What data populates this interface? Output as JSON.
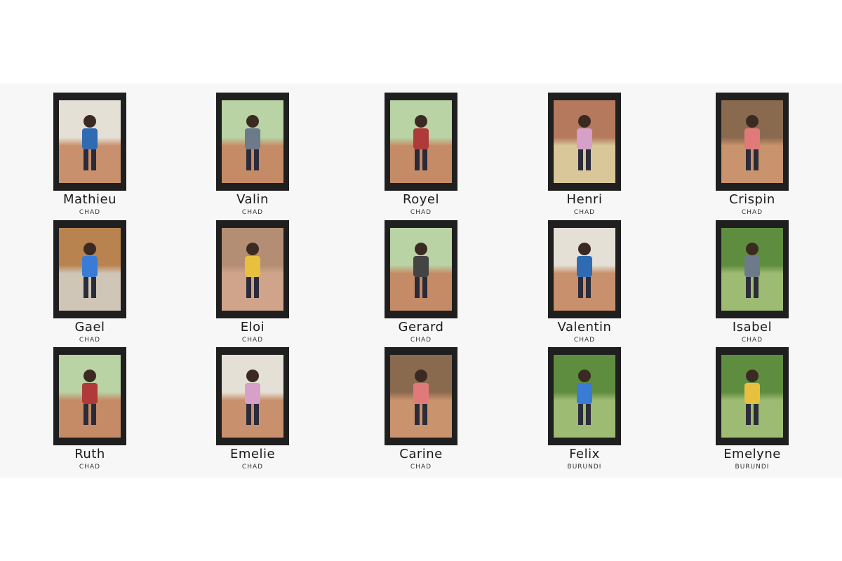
{
  "children": [
    {
      "name": "Mathieu",
      "country": "CHAD",
      "scene": "sand"
    },
    {
      "name": "Valin",
      "country": "CHAD",
      "scene": "field"
    },
    {
      "name": "Royel",
      "country": "CHAD",
      "scene": "field"
    },
    {
      "name": "Henri",
      "country": "CHAD",
      "scene": "mat"
    },
    {
      "name": "Crispin",
      "country": "CHAD",
      "scene": "hut"
    },
    {
      "name": "Gael",
      "country": "CHAD",
      "scene": "wall"
    },
    {
      "name": "Eloi",
      "country": "CHAD",
      "scene": "brick"
    },
    {
      "name": "Gerard",
      "country": "CHAD",
      "scene": "field"
    },
    {
      "name": "Valentin",
      "country": "CHAD",
      "scene": "sand"
    },
    {
      "name": "Isabel",
      "country": "CHAD",
      "scene": "green"
    },
    {
      "name": "Ruth",
      "country": "CHAD",
      "scene": "field"
    },
    {
      "name": "Emelie",
      "country": "CHAD",
      "scene": "sand"
    },
    {
      "name": "Carine",
      "country": "CHAD",
      "scene": "hut"
    },
    {
      "name": "Felix",
      "country": "BURUNDI",
      "scene": "green"
    },
    {
      "name": "Emelyne",
      "country": "BURUNDI",
      "scene": "green"
    }
  ],
  "colors": {
    "frame": "#1f1f1f",
    "band": "#f7f7f7",
    "soil": "#c98d6a",
    "sky": "#e9eef2",
    "foliage": "#5e8a3f",
    "shirt": [
      "#2f6bb3",
      "#6c7a8a",
      "#b03a3a",
      "#d6a0c8",
      "#e07a7a",
      "#3a7bd5",
      "#e8c040",
      "#444"
    ]
  }
}
